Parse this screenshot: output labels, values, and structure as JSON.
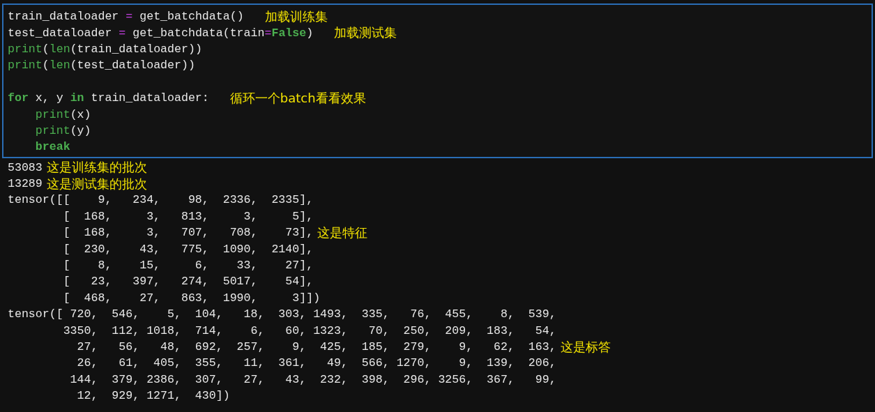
{
  "code_cell": {
    "lines": [
      {
        "tokens": [
          {
            "text": "train_dataloader ",
            "kind": "plain"
          },
          {
            "text": "=",
            "kind": "operator"
          },
          {
            "text": " get_batchdata()",
            "kind": "plain"
          }
        ],
        "annotation": "加载训练集"
      },
      {
        "tokens": [
          {
            "text": "test_dataloader ",
            "kind": "plain"
          },
          {
            "text": "=",
            "kind": "operator"
          },
          {
            "text": " get_batchdata(train",
            "kind": "plain"
          },
          {
            "text": "=",
            "kind": "operator"
          },
          {
            "text": "False",
            "kind": "constant"
          },
          {
            "text": ")",
            "kind": "plain"
          }
        ],
        "annotation": "加载测试集"
      },
      {
        "tokens": [
          {
            "text": "print",
            "kind": "builtin"
          },
          {
            "text": "(",
            "kind": "plain"
          },
          {
            "text": "len",
            "kind": "builtin"
          },
          {
            "text": "(train_dataloader))",
            "kind": "plain"
          }
        ]
      },
      {
        "tokens": [
          {
            "text": "print",
            "kind": "builtin"
          },
          {
            "text": "(",
            "kind": "plain"
          },
          {
            "text": "len",
            "kind": "builtin"
          },
          {
            "text": "(test_dataloader))",
            "kind": "plain"
          }
        ]
      },
      {
        "blank": true
      },
      {
        "tokens": [
          {
            "text": "for",
            "kind": "keyword"
          },
          {
            "text": " x, y ",
            "kind": "plain"
          },
          {
            "text": "in",
            "kind": "keyword"
          },
          {
            "text": " train_dataloader:",
            "kind": "plain"
          }
        ],
        "annotation": "循环一个batch看看效果"
      },
      {
        "indented": true,
        "tokens": [
          {
            "text": "print",
            "kind": "builtin"
          },
          {
            "text": "(x)",
            "kind": "plain"
          }
        ]
      },
      {
        "indented": true,
        "tokens": [
          {
            "text": "print",
            "kind": "builtin"
          },
          {
            "text": "(y)",
            "kind": "plain"
          }
        ]
      },
      {
        "indented": true,
        "tokens": [
          {
            "text": "break",
            "kind": "keyword"
          }
        ]
      }
    ]
  },
  "output": {
    "lines": [
      {
        "text": "53083",
        "annotation": "这是训练集的批次"
      },
      {
        "text": "13289",
        "annotation": "这是测试集的批次"
      },
      {
        "text": "tensor([[    9,   234,    98,  2336,  2335],"
      },
      {
        "text": "        [  168,     3,   813,     3,     5],"
      },
      {
        "text": "        [  168,     3,   707,   708,    73],",
        "annotation": "这是特征"
      },
      {
        "text": "        [  230,    43,   775,  1090,  2140],"
      },
      {
        "text": "        [    8,    15,     6,    33,    27],"
      },
      {
        "text": "        [   23,   397,   274,  5017,    54],"
      },
      {
        "text": "        [  468,    27,   863,  1990,     3]])"
      },
      {
        "text": "tensor([ 720,  546,    5,  104,   18,  303, 1493,  335,   76,  455,    8,  539,"
      },
      {
        "text": "        3350,  112, 1018,  714,    6,   60, 1323,   70,  250,  209,  183,   54,"
      },
      {
        "text": "          27,   56,   48,  692,  257,    9,  425,  185,  279,    9,   62,  163,",
        "annotation": "这是标答"
      },
      {
        "text": "          26,   61,  405,  355,   11,  361,   49,  566, 1270,    9,  139,  206,"
      },
      {
        "text": "         144,  379, 2386,  307,   27,   43,  232,  398,  296, 3256,  367,   99,"
      },
      {
        "text": "          12,  929, 1271,  430])"
      }
    ]
  }
}
